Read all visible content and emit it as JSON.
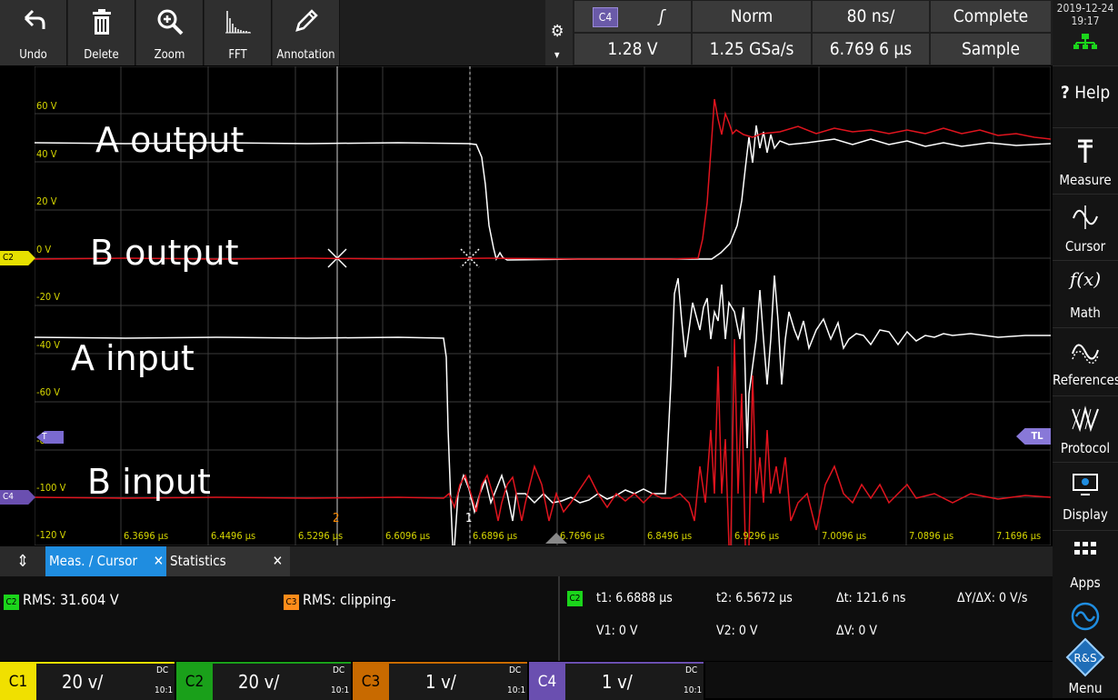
{
  "toolbar": {
    "undo": "Undo",
    "delete": "Delete",
    "zoom": "Zoom",
    "fft": "FFT",
    "annotation": "Annotation"
  },
  "acq": {
    "channel_badge": "C4",
    "trigger_mode": "Norm",
    "timebase": "80 ns/",
    "status": "Complete",
    "trigger_level": "1.28 V",
    "sample_rate": "1.25 GSa/s",
    "position": "6.769 6 µs",
    "acq_mode": "Sample"
  },
  "clock": {
    "date": "2019-12-24",
    "time": "19:17"
  },
  "sidebar": [
    {
      "label": "Help",
      "icon": "help-icon"
    },
    {
      "label": "Measure",
      "icon": "measure-icon"
    },
    {
      "label": "Cursor",
      "icon": "cursor-icon"
    },
    {
      "label": "Math",
      "icon": "math-icon"
    },
    {
      "label": "References",
      "icon": "references-icon"
    },
    {
      "label": "Protocol",
      "icon": "protocol-icon"
    },
    {
      "label": "Display",
      "icon": "display-icon"
    },
    {
      "label": "Apps",
      "icon": "apps-icon"
    },
    {
      "label": "Menu",
      "icon": "menu-icon"
    }
  ],
  "y_axis": [
    "60 V",
    "40 V",
    "20 V",
    "0 V",
    "-20 V",
    "-40 V",
    "-60 V",
    "-80 V",
    "-100 V",
    "-120 V"
  ],
  "x_axis": [
    "6.3696 µs",
    "6.4496 µs",
    "6.5296 µs",
    "6.6096 µs",
    "6.6896 µs",
    "6.7696 µs",
    "6.8496 µs",
    "6.9296 µs",
    "7.0096 µs",
    "7.0896 µs",
    "7.1696 µs"
  ],
  "overlays": {
    "a_out": "A output",
    "b_out": "B output",
    "a_in": "A input",
    "b_in": "B input"
  },
  "markers": {
    "c2": "C2",
    "c4": "C4",
    "tl": "TL",
    "t": "T",
    "cursor1": "1",
    "cursor2": "2"
  },
  "tabs": {
    "meas": "Meas. / Cursor",
    "stats": "Statistics"
  },
  "measurements": {
    "m1_ch": "C2",
    "m1": "RMS: 31.604 V",
    "m2_ch": "C3",
    "m2": "RMS: clipping-",
    "cur_ch": "C2",
    "t1": "t1: 6.6888 µs",
    "t2": "t2: 6.5672 µs",
    "dt": "Δt: 121.6 ns",
    "dydx": "ΔY/ΔX: 0 V/s",
    "v1": "V1: 0 V",
    "v2": "V2: 0 V",
    "dv": "ΔV: 0 V"
  },
  "channels": [
    {
      "name": "C1",
      "scale": "20 v/",
      "coupling": "DC",
      "probe": "10:1",
      "color": "#f0e000"
    },
    {
      "name": "C2",
      "scale": "20 v/",
      "coupling": "DC",
      "probe": "10:1",
      "color": "#1aa01a"
    },
    {
      "name": "C3",
      "scale": "1 v/",
      "coupling": "DC",
      "probe": "10:1",
      "color": "#c86a00"
    },
    {
      "name": "C4",
      "scale": "1 v/",
      "coupling": "DC",
      "probe": "10:1",
      "color": "#6a4fb0"
    }
  ],
  "colors": {
    "trace_white": "#ffffff",
    "trace_red": "#e0141e",
    "axis_label": "#d6d600",
    "accent_blue": "#1f8de0"
  }
}
